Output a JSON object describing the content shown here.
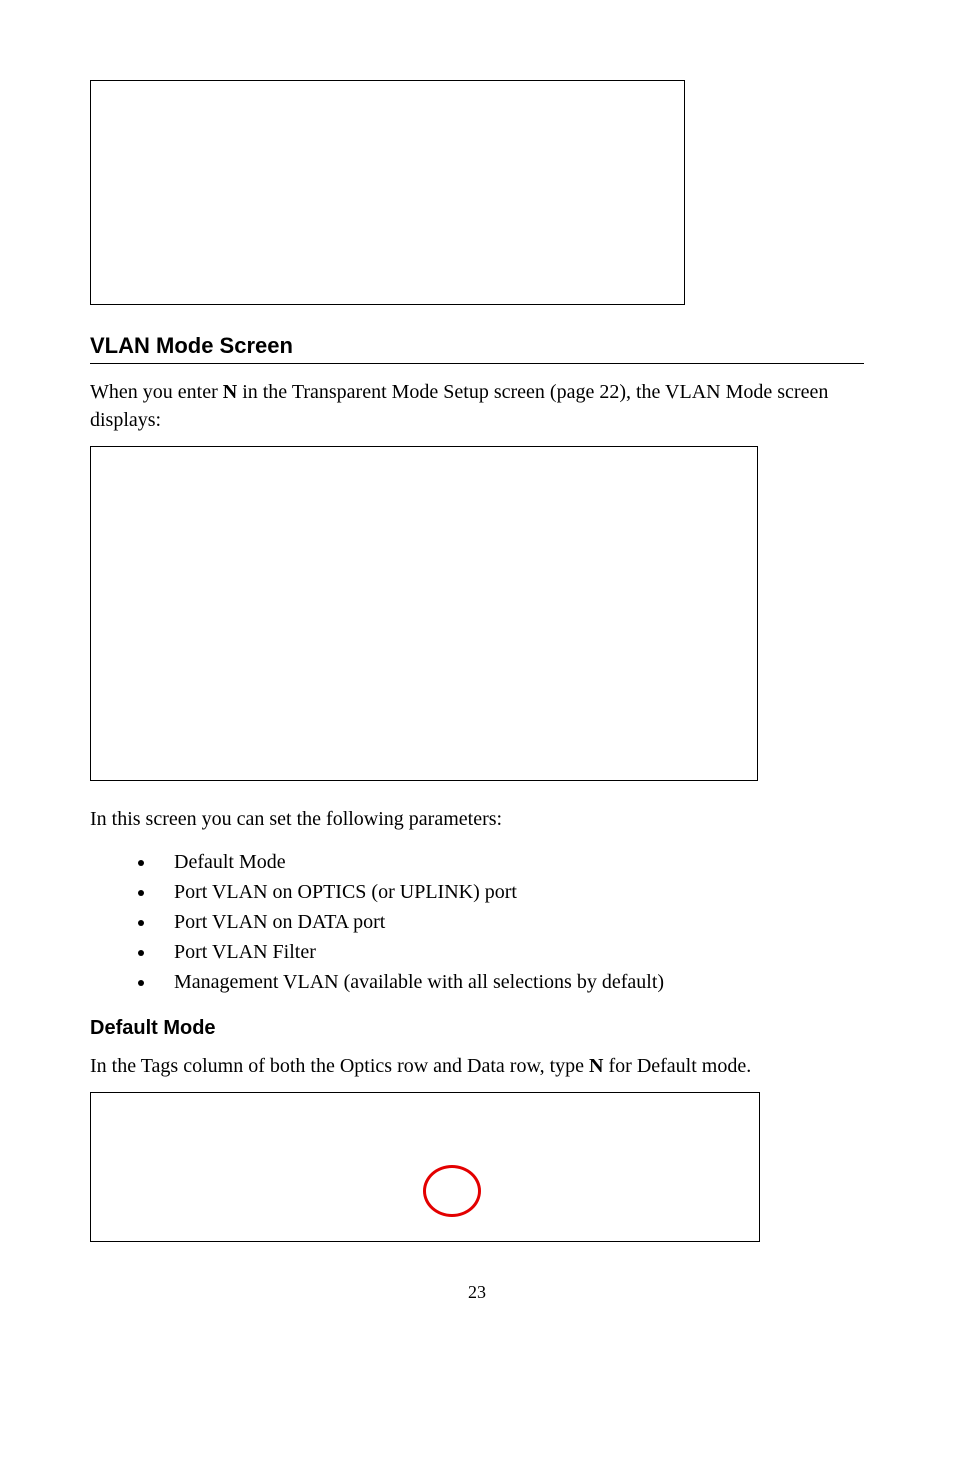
{
  "heading1": "VLAN Mode Screen",
  "para1_part1": "When you enter ",
  "para1_bold1": "N",
  "para1_part2": " in the Transparent Mode Setup screen (page 22), the VLAN Mode screen displays:",
  "para2": "In this screen you can set the following parameters:",
  "bullets": [
    "Default Mode",
    "Port VLAN on OPTICS (or UPLINK) port",
    "Port VLAN on DATA port",
    "Port VLAN Filter",
    "Management VLAN (available with all selections by default)"
  ],
  "heading2": "Default Mode",
  "para3_part1": "In the Tags column of both the Optics row and Data row, type ",
  "para3_bold1": "N",
  "para3_part2": " for Default mode.",
  "page_number": "23"
}
